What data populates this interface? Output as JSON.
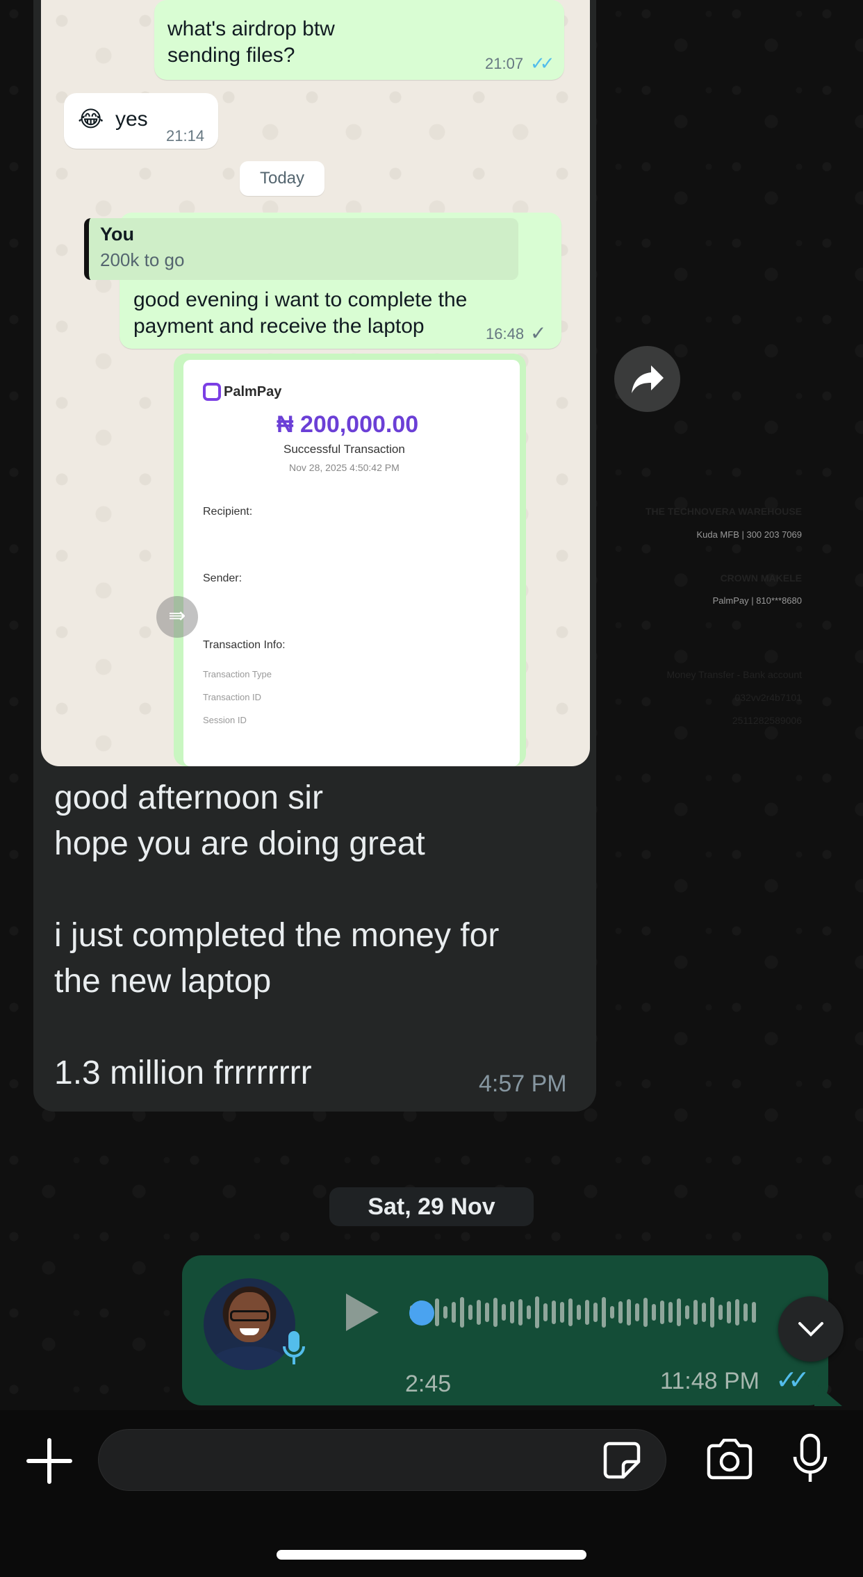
{
  "screenshot": {
    "msg1_text": "what's airdrop btw\nsending files?",
    "msg1_time": "21:07",
    "msg1_ticks": "✓✓",
    "msg2_emoji": "😂",
    "msg2_text": "yes",
    "msg2_time": "21:14",
    "day_chip": "Today",
    "quote_author": "You",
    "quote_text": "200k to go",
    "msg3_text": "good evening i want to complete the\npayment and receive the laptop",
    "msg3_time": "16:48",
    "msg3_tick": "✓",
    "receipt": {
      "brand": "PalmPay",
      "amount": "₦ 200,000.00",
      "status": "Successful Transaction",
      "date": "Nov 28, 2025 4:50:42 PM",
      "recipient_label": "Recipient:",
      "recipient_name": "THE TECHNOVERA WAREHOUSE",
      "recipient_bank": "Kuda MFB | 300 203 7069",
      "sender_label": "Sender:",
      "sender_name": "CROWN MAKELE",
      "sender_bank": "PalmPay | 810***8680",
      "info_label": "Transaction Info:",
      "type_label": "Transaction Type",
      "type_value": "Money Transfer - Bank account",
      "id_label": "Transaction ID",
      "id_value": "032vv2r4b7101",
      "session_label": "Session ID",
      "session_value": "2511282589006"
    }
  },
  "message": {
    "text": "good afternoon sir\nhope you are doing great\n\ni just completed the money for\nthe new laptop\n\n1.3 million frrrrrrrr",
    "time": "4:57 PM"
  },
  "date_chip": "Sat, 29 Nov",
  "voice_note": {
    "duration": "2:45",
    "time": "11:48 PM",
    "ticks": "✓✓",
    "progress": 0
  },
  "icons": {
    "forward": "forward-icon",
    "scroll_down": "chevron-down-icon",
    "attach": "plus-icon",
    "sticker": "sticker-icon",
    "camera": "camera-icon",
    "mic": "mic-icon"
  },
  "colors": {
    "outgoing_bubble": "#144d37",
    "incoming_bubble": "#242626",
    "read_ticks": "#53bdeb",
    "palmpay": "#6b3fd6"
  }
}
